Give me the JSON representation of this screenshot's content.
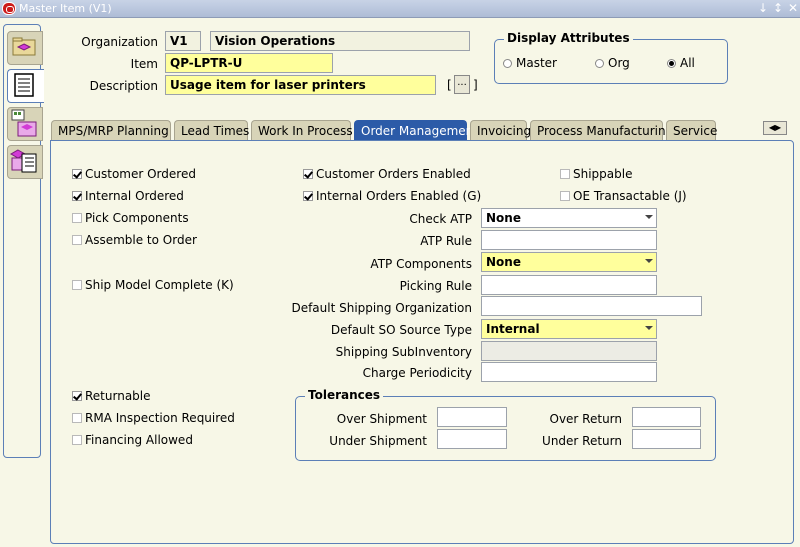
{
  "window": {
    "title": "Master Item (V1)",
    "controls": [
      "↓",
      "↕",
      "✕"
    ]
  },
  "header": {
    "org_label": "Organization",
    "org_code": "V1",
    "org_name": "Vision Operations",
    "item_label": "Item",
    "item_value": "QP-LPTR-U",
    "desc_label": "Description",
    "desc_value": "Usage item for laser printers",
    "more_button": "...",
    "bracket_open": "[",
    "bracket_close": "]"
  },
  "display_attributes": {
    "title": "Display Attributes",
    "options": [
      "Master",
      "Org",
      "All"
    ],
    "selected": "All"
  },
  "tabs": [
    "MPS/MRP Planning",
    "Lead Times",
    "Work In Process",
    "Order Management",
    "Invoicing",
    "Process Manufacturing",
    "Service"
  ],
  "active_tab": "Order Management",
  "left_column": {
    "customer_ordered": "Customer Ordered",
    "internal_ordered": "Internal Ordered",
    "pick_components": "Pick Components",
    "assemble_to_order": "Assemble to Order",
    "ship_model_complete": "Ship Model Complete (K)",
    "returnable": "Returnable",
    "rma_inspection": "RMA Inspection Required",
    "financing_allowed": "Financing Allowed"
  },
  "middle_column": {
    "customer_orders_enabled": "Customer Orders Enabled",
    "internal_orders_enabled": "Internal Orders Enabled (G)"
  },
  "right_column": {
    "shippable": "Shippable",
    "oe_transactable": "OE Transactable (J)"
  },
  "fields": {
    "check_atp_label": "Check ATP",
    "check_atp_value": "None",
    "atp_rule_label": "ATP Rule",
    "atp_rule_value": "",
    "atp_components_label": "ATP Components",
    "atp_components_value": "None",
    "picking_rule_label": "Picking Rule",
    "picking_rule_value": "",
    "default_shipping_org_label": "Default Shipping Organization",
    "default_shipping_org_value": "",
    "default_so_source_label": "Default SO Source Type",
    "default_so_source_value": "Internal",
    "shipping_subinventory_label": "Shipping SubInventory",
    "shipping_subinventory_value": "",
    "charge_periodicity_label": "Charge Periodicity",
    "charge_periodicity_value": ""
  },
  "tolerances": {
    "title": "Tolerances",
    "over_shipment": "Over Shipment",
    "under_shipment": "Under Shipment",
    "over_return": "Over Return",
    "under_return": "Under Return"
  },
  "checked": {
    "customer_ordered": true,
    "internal_ordered": true,
    "pick_components": false,
    "assemble_to_order": false,
    "ship_model_complete": false,
    "returnable": true,
    "rma_inspection": false,
    "financing_allowed": false,
    "customer_orders_enabled": true,
    "internal_orders_enabled": true,
    "shippable": false,
    "oe_transactable": false
  },
  "colors": {
    "accent": "#2c5ba8",
    "required": "#ffff9c",
    "panel_bg": "#f7f7e7"
  }
}
